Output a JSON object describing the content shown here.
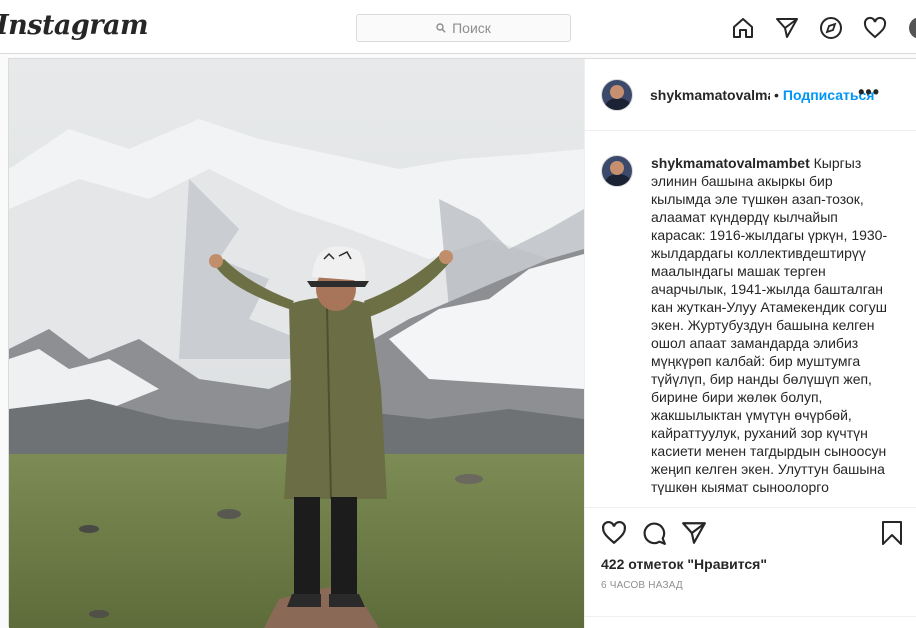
{
  "topbar": {
    "logo": "Instagram",
    "search_placeholder": "Поиск"
  },
  "nav_icons": [
    "home-icon",
    "direct-icon",
    "explore-icon",
    "heart-icon",
    "profile-avatar"
  ],
  "post": {
    "username_header": "shykmamatovalmambet",
    "dot": "•",
    "follow_label": "Подписаться",
    "more_label": "•••",
    "caption_username": "shykmamatovalmambet",
    "caption_text": "Кыргыз элинин башына акыркы бир кылымда эле түшкөн азап-тозок, алаамат күндөрдү кылчайып карасак: 1916-жылдагы үркүн, 1930-жылдардагы коллективдештирүү маалындагы машак терген ачарчылык, 1941-жылда башталган кан жуткан-Улуу Атамекендик согуш экен. Журтубуздун башына келген ошол апаат замандарда элибиз мүңкүрөп калбай: бир муштумга түйүлүп, бир нанды бөлүшүп жеп, бирине бири жөлөк болуп, жакшылыктан үмүтүн өчүрбөй, кайраттуулук, руханий зор күчтүн касиети менен тагдырдын сыноосун жеңип келген экен. Улуттун башына түшкөн кыямат сыноолорго",
    "likes_count": "422 отметок",
    "likes_label": "\"Нравится\"",
    "timestamp": "6 ЧАСОВ НАЗАД"
  },
  "colors": {
    "accent": "#0095f6",
    "border": "#dbdbdb",
    "text": "#262626",
    "muted": "#8e8e8e"
  }
}
